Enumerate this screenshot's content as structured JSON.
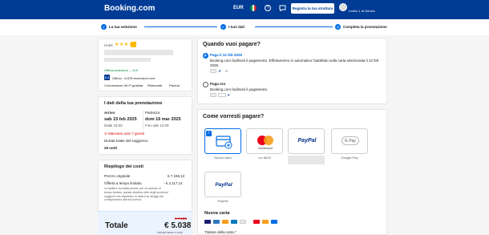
{
  "header": {
    "logo": "Booking.com",
    "currency": "EUR",
    "help_glyph": "?",
    "register_button": "Registra la tua struttura",
    "account_label": "Livello 1 di Genius",
    "colors": {
      "brand": "#003b95",
      "accent": "#006ce4"
    }
  },
  "steps": [
    {
      "label": "La tua selezione",
      "marker": "✓"
    },
    {
      "label": "I tuoi dati",
      "marker": "✓"
    },
    {
      "label": "Completa la prenotazione",
      "marker": "3"
    }
  ],
  "hotel": {
    "type": "Hotel",
    "stars": "★★★★",
    "location": "Ottima posizione — 8.8",
    "score": "8.4",
    "score_label": "Ottimo · 6.878 recensioni vere",
    "amenities": [
      "Connessione Wi-Fi gratuita",
      "Ristorante",
      "Piscina"
    ]
  },
  "booking": {
    "title": "I dati della tua prenotazione",
    "checkin_label": "Arrivo",
    "checkin_date": "sab 15 feb 2025",
    "checkin_time": "Dalle 15:00",
    "checkout_label": "Partenza",
    "checkout_date": "dom 16 mar 2025",
    "checkout_time": "Fino alle 12:00",
    "warning": "Mancano solo 7 giorni!",
    "duration_label": "Durata totale del soggiorno:",
    "duration": "29 notti"
  },
  "price": {
    "title": "Riepilogo dei costi",
    "original_label": "Prezzo originale",
    "original_value": "€ 7.155,12",
    "offer_label": "Offerta a tempo limitato",
    "offer_value": "- € 2.117,14",
    "offer_desc": "La tariffa è scontata perché, per un periodo di tempo limitato, questa struttura offre degli sconti sui soggiorni che rispettano la data e su alloggi che corrispondono alla tua ricerca.",
    "total_label": "Totale",
    "total_old": "€ 7.155",
    "total_value": "€ 5.038",
    "total_note": "Include tasse e costi"
  },
  "when_pay": {
    "title": "Quando vuoi pagare?",
    "option1_title": "Paga il 12 feb 2025",
    "option1_desc": "Booking.com faciliterà il pagamento. Effettueremo in automatico l'addebito sulla carta selezionata il 12 feb 2025.",
    "option2_title": "Paga ora",
    "option2_desc": "Booking.com faciliterà il pagamento."
  },
  "how_pay": {
    "title": "Come vorresti pagare?",
    "methods": [
      {
        "label": "Nuova carta"
      },
      {
        "label": "•••• 8629"
      },
      {
        "label": "PayPal"
      },
      {
        "label": "Google Pay"
      }
    ],
    "paypal_caption": "PayPal",
    "gpay_logo": "G Pay",
    "mastercard_logo": "mastercard",
    "new_card_title": "Nuova carta",
    "holder_label": "Titolare della carta *"
  }
}
